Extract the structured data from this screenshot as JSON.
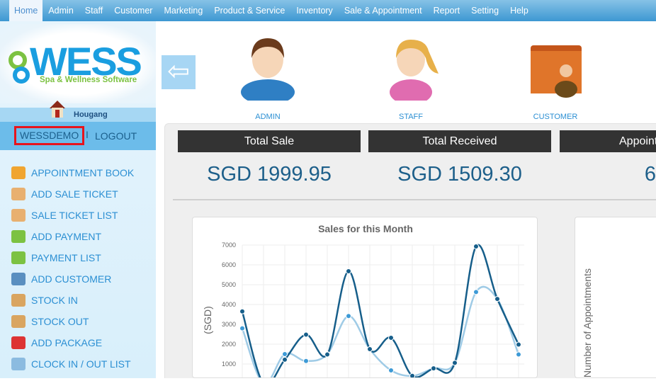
{
  "nav": {
    "items": [
      "Home",
      "Admin",
      "Staff",
      "Customer",
      "Marketing",
      "Product & Service",
      "Inventory",
      "Sale & Appointment",
      "Report",
      "Setting",
      "Help"
    ],
    "active": "Home"
  },
  "logo": {
    "name": "WESS",
    "tagline": "Spa & Wellness Software"
  },
  "branch": {
    "name": "Hougang"
  },
  "user": {
    "username": "WESSDEMO",
    "separator": "I",
    "logout": "LOGOUT"
  },
  "menu": [
    {
      "label": "APPOINTMENT BOOK",
      "icon": "appointment-book-icon",
      "color": "#f0a530"
    },
    {
      "label": "ADD SALE TICKET",
      "icon": "sale-ticket-icon",
      "color": "#e8b070"
    },
    {
      "label": "SALE TICKET LIST",
      "icon": "sale-ticket-icon",
      "color": "#e8b070"
    },
    {
      "label": "ADD PAYMENT",
      "icon": "money-icon",
      "color": "#7cc242"
    },
    {
      "label": "PAYMENT LIST",
      "icon": "money-icon",
      "color": "#7cc242"
    },
    {
      "label": "ADD CUSTOMER",
      "icon": "customer-card-icon",
      "color": "#5a8fc0"
    },
    {
      "label": "STOCK IN",
      "icon": "box-icon",
      "color": "#d9a560"
    },
    {
      "label": "STOCK OUT",
      "icon": "box-icon",
      "color": "#d9a560"
    },
    {
      "label": "ADD PACKAGE",
      "icon": "package-icon",
      "color": "#d33"
    },
    {
      "label": "CLOCK IN / OUT LIST",
      "icon": "clock-icon",
      "color": "#8bbbe0"
    }
  ],
  "quick": [
    {
      "label": "ADMIN"
    },
    {
      "label": "STAFF"
    },
    {
      "label": "CUSTOMER"
    }
  ],
  "stats": [
    {
      "title": "Total Sale",
      "value": "SGD 1999.95"
    },
    {
      "title": "Total Received",
      "value": "SGD 1509.30"
    },
    {
      "title": "Appoint",
      "value": "6"
    }
  ],
  "chart_data": {
    "type": "line",
    "title": "Sales for this Month",
    "ylabel": "(SGD)",
    "ylim": [
      0,
      7000
    ],
    "yticks": [
      1000,
      2000,
      3000,
      4000,
      5000,
      6000,
      7000
    ],
    "grid": true,
    "series": [
      {
        "color": "#165e8a",
        "values": [
          3650,
          0,
          1220,
          2480,
          1480,
          5680,
          1750,
          2320,
          400,
          780,
          1060,
          6930,
          4280,
          1980
        ]
      },
      {
        "color": "#3d9ad6",
        "line_color": "#9fcbe6",
        "values": [
          2800,
          0,
          1500,
          1150,
          1500,
          3420,
          1750,
          680,
          400,
          780,
          1060,
          4630,
          4280,
          1480
        ]
      }
    ]
  },
  "chart2": {
    "ylabel": "Number of Appointments"
  }
}
